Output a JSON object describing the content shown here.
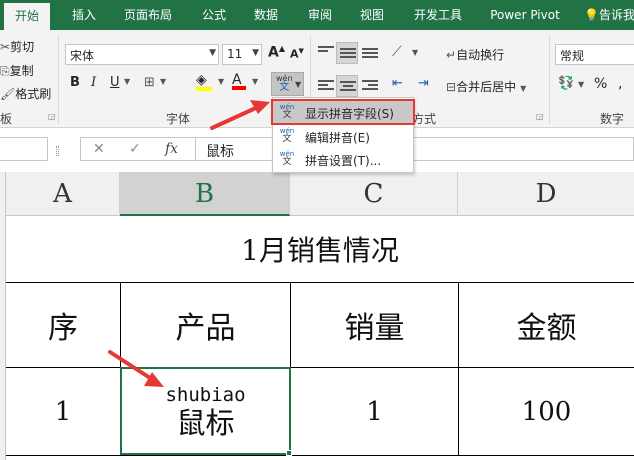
{
  "tabs": [
    "开始",
    "插入",
    "页面布局",
    "公式",
    "数据",
    "审阅",
    "视图",
    "开发工具",
    "Power Pivot",
    "告诉我"
  ],
  "clipboard": {
    "cut": "剪切",
    "copy": "复制",
    "format_painter": "格式刷",
    "group": "板"
  },
  "font": {
    "name": "宋体",
    "size": "11",
    "bold": "B",
    "italic": "I",
    "underline": "U",
    "grow": "A",
    "shrink": "A",
    "font_color_letter": "A",
    "wen_top": "wén",
    "wen_bottom": "文",
    "group": "字体"
  },
  "alignment": {
    "wrap_text": "自动换行",
    "merge_center": "合并后居中",
    "group_tail": "方式"
  },
  "number": {
    "format": "常规",
    "percent": "%",
    "group": "数字"
  },
  "dropdown": {
    "items": [
      {
        "label": "显示拼音字段(S)"
      },
      {
        "label": "编辑拼音(E)"
      },
      {
        "label": "拼音设置(T)..."
      }
    ]
  },
  "formula_bar": {
    "cancel": "✕",
    "enter": "✓",
    "fx": "fx",
    "content": "鼠标"
  },
  "columns": [
    "A",
    "B",
    "C",
    "D"
  ],
  "sheet": {
    "title": "1月销售情况",
    "headers": [
      "序",
      "产品",
      "销量",
      "金额"
    ],
    "row1": {
      "seq": "1",
      "product_pinyin": "shubiao",
      "product": "鼠标",
      "qty": "1",
      "amount": "100"
    }
  },
  "colors": {
    "accent": "#217346",
    "highlight": "#e53935",
    "arrow": "#e53935"
  }
}
